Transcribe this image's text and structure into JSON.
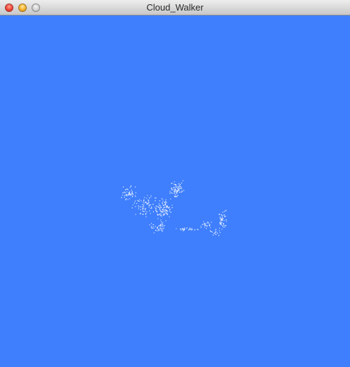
{
  "window": {
    "title": "Cloud_Walker",
    "controls": [
      "close-button",
      "minimize-button",
      "zoom-button"
    ]
  },
  "canvas": {
    "background_color": "#3f7ffe",
    "point_color": "#ffffff"
  }
}
